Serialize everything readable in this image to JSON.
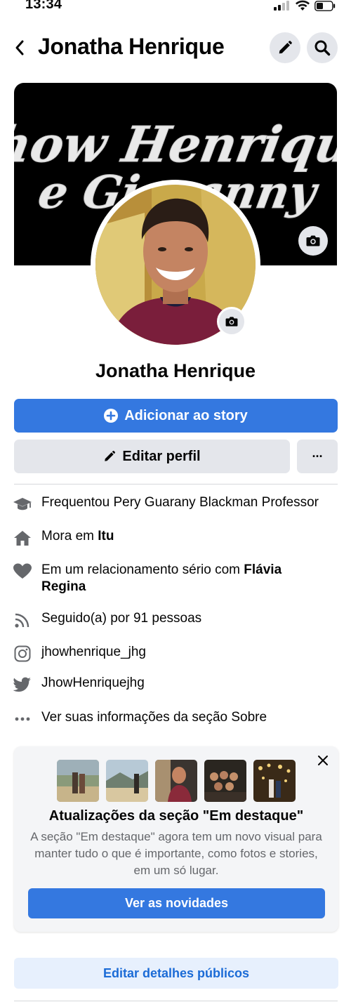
{
  "status_bar": {
    "time": "13:34"
  },
  "topbar": {
    "title": "Jonatha Henrique",
    "back_icon": "chevron-left-icon",
    "edit_icon": "pencil-icon",
    "search_icon": "search-icon"
  },
  "cover": {
    "text_line1": "Jhow Henrique",
    "text_line2": "e Giovanny",
    "camera_icon": "camera-icon"
  },
  "profile": {
    "name": "Jonatha Henrique",
    "camera_icon": "camera-icon"
  },
  "actions": {
    "add_story_label": "Adicionar ao story",
    "edit_profile_label": "Editar perfil",
    "more_label": "···"
  },
  "info": {
    "education": "Frequentou Pery Guarany Blackman Professor",
    "lives_prefix": "Mora em ",
    "lives_city": "Itu",
    "relationship_prefix": "Em um relacionamento sério com ",
    "relationship_partner": "Flávia Regina",
    "followers": "Seguido(a) por 91 pessoas",
    "instagram": "jhowhenrique_jhg",
    "twitter": "JhowHenriquejhg",
    "about": "Ver suas informações da seção Sobre"
  },
  "featured_card": {
    "title": "Atualizações da seção \"Em destaque\"",
    "description": "A seção \"Em destaque\" agora tem um novo visual para manter tudo o que é importante, como fotos e stories, em um só lugar.",
    "button_label": "Ver as novidades"
  },
  "edit_public_label": "Editar detalhes públicos",
  "colors": {
    "primary": "#3478e0",
    "gray_button": "#e4e6eb",
    "link": "#1b6bd6",
    "muted_text": "#65676b"
  }
}
